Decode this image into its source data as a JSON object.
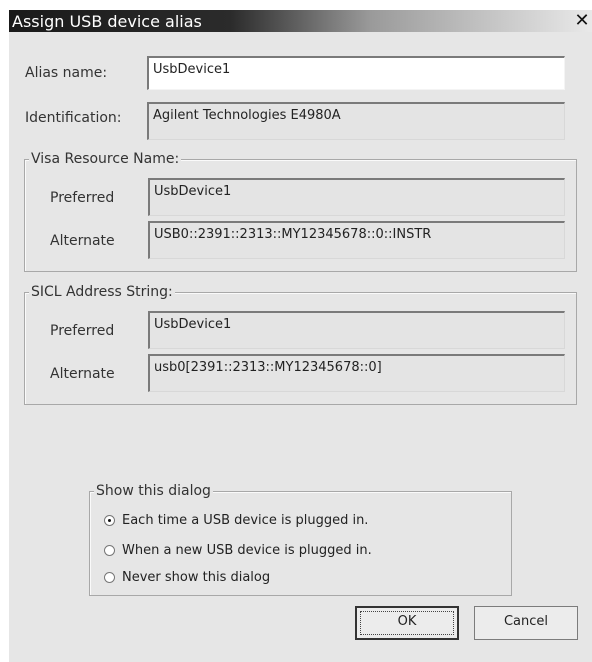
{
  "window": {
    "title": "Assign USB device alias",
    "close_glyph": "✕"
  },
  "alias": {
    "label": "Alias name:",
    "value": "UsbDevice1"
  },
  "identification": {
    "label": "Identification:",
    "value": "Agilent Technologies E4980A"
  },
  "visa": {
    "legend": "Visa Resource Name:",
    "preferred_label": "Preferred",
    "preferred_value": "UsbDevice1",
    "alternate_label": "Alternate",
    "alternate_value": "USB0::2391::2313::MY12345678::0::INSTR"
  },
  "sicl": {
    "legend": "SICL Address String:",
    "preferred_label": "Preferred",
    "preferred_value": "UsbDevice1",
    "alternate_label": "Alternate",
    "alternate_value": "usb0[2391::2313::MY12345678::0]"
  },
  "show_dialog": {
    "legend": "Show this dialog",
    "options": [
      {
        "label": "Each time a USB device is plugged in.",
        "checked": true
      },
      {
        "label": "When a new USB device is plugged in.",
        "checked": false
      },
      {
        "label": "Never show this dialog",
        "checked": false
      }
    ]
  },
  "buttons": {
    "ok": "OK",
    "cancel": "Cancel"
  }
}
